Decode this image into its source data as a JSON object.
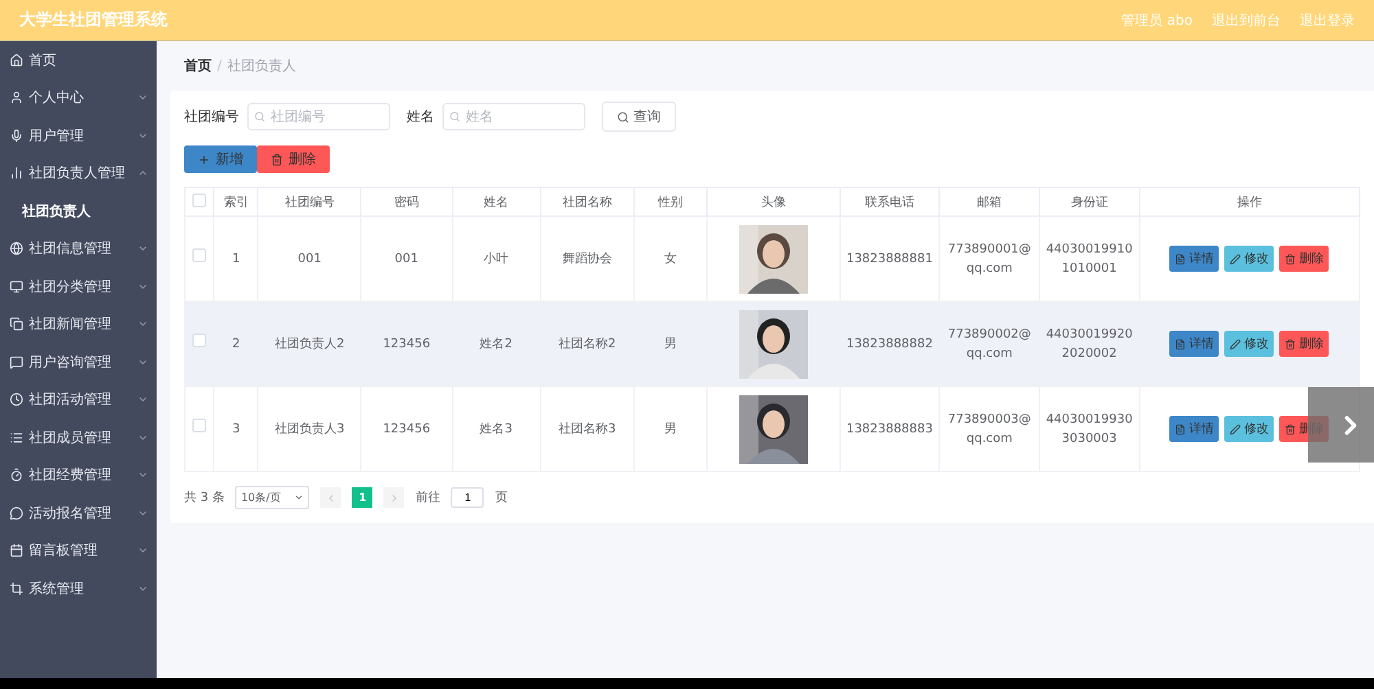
{
  "header": {
    "title": "大学生社团管理系统",
    "links": [
      "管理员 abo",
      "退出到前台",
      "退出登录"
    ]
  },
  "sidebar": {
    "items": [
      {
        "label": "首页"
      },
      {
        "label": "个人中心",
        "expanded": false
      },
      {
        "label": "用户管理",
        "expanded": false
      },
      {
        "label": "社团负责人管理",
        "expanded": true,
        "children": [
          {
            "label": "社团负责人",
            "selected": true
          }
        ]
      },
      {
        "label": "社团信息管理",
        "expanded": false
      },
      {
        "label": "社团分类管理",
        "expanded": false
      },
      {
        "label": "社团新闻管理",
        "expanded": false
      },
      {
        "label": "用户咨询管理",
        "expanded": false
      },
      {
        "label": "社团活动管理",
        "expanded": false
      },
      {
        "label": "社团成员管理",
        "expanded": false
      },
      {
        "label": "社团经费管理",
        "expanded": false
      },
      {
        "label": "活动报名管理",
        "expanded": false
      },
      {
        "label": "留言板管理",
        "expanded": false
      },
      {
        "label": "系统管理",
        "expanded": false
      }
    ]
  },
  "breadcrumb": {
    "items": [
      "首页",
      "社团负责人"
    ],
    "separator": "/"
  },
  "search": {
    "fields": [
      {
        "label": "社团编号",
        "placeholder": "社团编号"
      },
      {
        "label": "姓名",
        "placeholder": "姓名"
      }
    ],
    "button": "查询"
  },
  "actions": [
    {
      "label": "新增",
      "kind": "add"
    },
    {
      "label": "删除",
      "kind": "delete"
    }
  ],
  "table": {
    "select_all": {
      "checked": false
    },
    "columns": [
      "索引",
      "社团编号",
      "密码",
      "姓名",
      "社团名称",
      "性别",
      "头像",
      "联系电话",
      "邮箱",
      "身份证",
      "操作"
    ],
    "rows": [
      {
        "checked": false,
        "highlighted": false,
        "cells": [
          "1",
          "001",
          "001",
          "小叶",
          "舞蹈协会",
          "女"
        ],
        "tail": [
          "13823888881",
          "773890001@qq.com",
          "440300199101010001"
        ],
        "buttons": [
          {
            "label": "详情",
            "kind": "detail"
          },
          {
            "label": "修改",
            "kind": "edit"
          },
          {
            "label": "删除",
            "kind": "delete"
          }
        ]
      },
      {
        "checked": false,
        "highlighted": true,
        "cells": [
          "2",
          "社团负责人2",
          "123456",
          "姓名2",
          "社团名称2",
          "男"
        ],
        "tail": [
          "13823888882",
          "773890002@qq.com",
          "440300199202020002"
        ],
        "buttons": [
          {
            "label": "详情",
            "kind": "detail"
          },
          {
            "label": "修改",
            "kind": "edit"
          },
          {
            "label": "删除",
            "kind": "delete"
          }
        ]
      },
      {
        "checked": false,
        "highlighted": false,
        "cells": [
          "3",
          "社团负责人3",
          "123456",
          "姓名3",
          "社团名称3",
          "男"
        ],
        "tail": [
          "13823888883",
          "773890003@qq.com",
          "440300199303030003"
        ],
        "buttons": [
          {
            "label": "详情",
            "kind": "detail"
          },
          {
            "label": "修改",
            "kind": "edit"
          },
          {
            "label": "删除",
            "kind": "delete"
          }
        ]
      }
    ]
  },
  "pagination": {
    "total": "共 3 条",
    "page_size": "10条/页",
    "pages": [
      {
        "label": "1",
        "selected": true
      }
    ],
    "goto_label": "前往",
    "goto_value": "1",
    "goto_suffix": "页"
  }
}
